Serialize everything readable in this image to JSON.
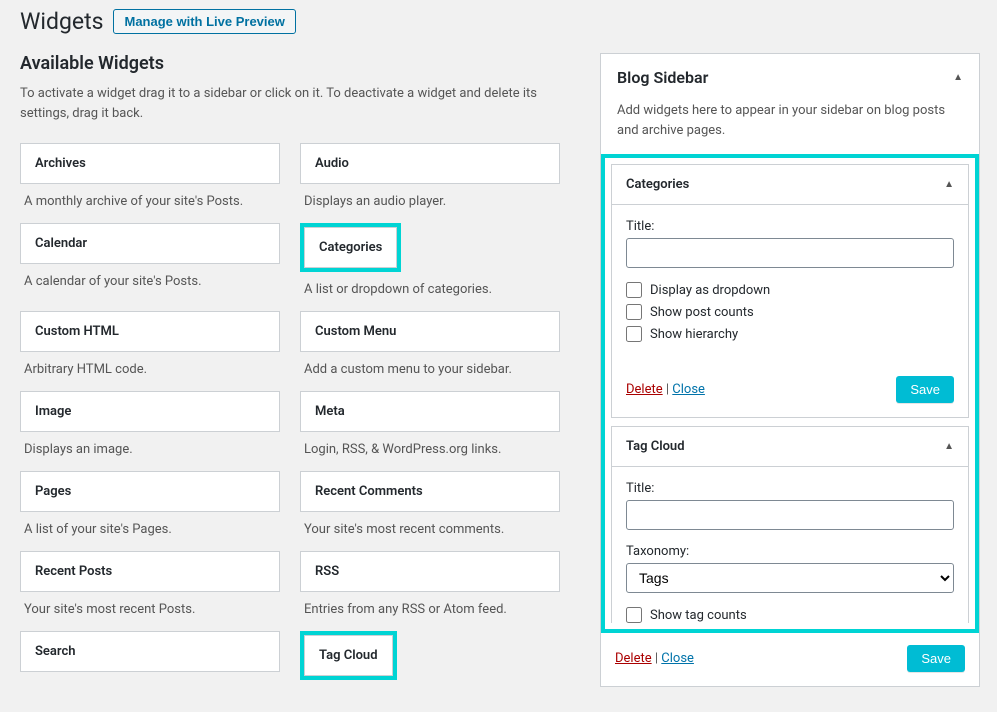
{
  "header": {
    "title": "Widgets",
    "preview_button": "Manage with Live Preview"
  },
  "available": {
    "title": "Available Widgets",
    "desc": "To activate a widget drag it to a sidebar or click on it. To deactivate a widget and delete its settings, drag it back.",
    "widgets": [
      {
        "title": "Archives",
        "desc": "A monthly archive of your site's Posts."
      },
      {
        "title": "Audio",
        "desc": "Displays an audio player."
      },
      {
        "title": "Calendar",
        "desc": "A calendar of your site's Posts."
      },
      {
        "title": "Categories",
        "desc": "A list or dropdown of categories.",
        "highlight": true
      },
      {
        "title": "Custom HTML",
        "desc": "Arbitrary HTML code."
      },
      {
        "title": "Custom Menu",
        "desc": "Add a custom menu to your sidebar."
      },
      {
        "title": "Image",
        "desc": "Displays an image."
      },
      {
        "title": "Meta",
        "desc": "Login, RSS, & WordPress.org links."
      },
      {
        "title": "Pages",
        "desc": "A list of your site's Pages."
      },
      {
        "title": "Recent Comments",
        "desc": "Your site's most recent comments."
      },
      {
        "title": "Recent Posts",
        "desc": "Your site's most recent Posts."
      },
      {
        "title": "RSS",
        "desc": "Entries from any RSS or Atom feed."
      },
      {
        "title": "Search",
        "desc": ""
      },
      {
        "title": "Tag Cloud",
        "desc": "",
        "highlight": true
      }
    ]
  },
  "sidebar": {
    "title": "Blog Sidebar",
    "desc": "Add widgets here to appear in your sidebar on blog posts and archive pages."
  },
  "categories_widget": {
    "title": "Categories",
    "label_title": "Title:",
    "opt_dropdown": "Display as dropdown",
    "opt_counts": "Show post counts",
    "opt_hierarchy": "Show hierarchy",
    "delete": "Delete",
    "close": "Close",
    "save": "Save"
  },
  "tagcloud_widget": {
    "title": "Tag Cloud",
    "label_title": "Title:",
    "label_taxonomy": "Taxonomy:",
    "taxonomy_selected": "Tags",
    "opt_counts": "Show tag counts",
    "delete": "Delete",
    "close": "Close",
    "save": "Save"
  }
}
